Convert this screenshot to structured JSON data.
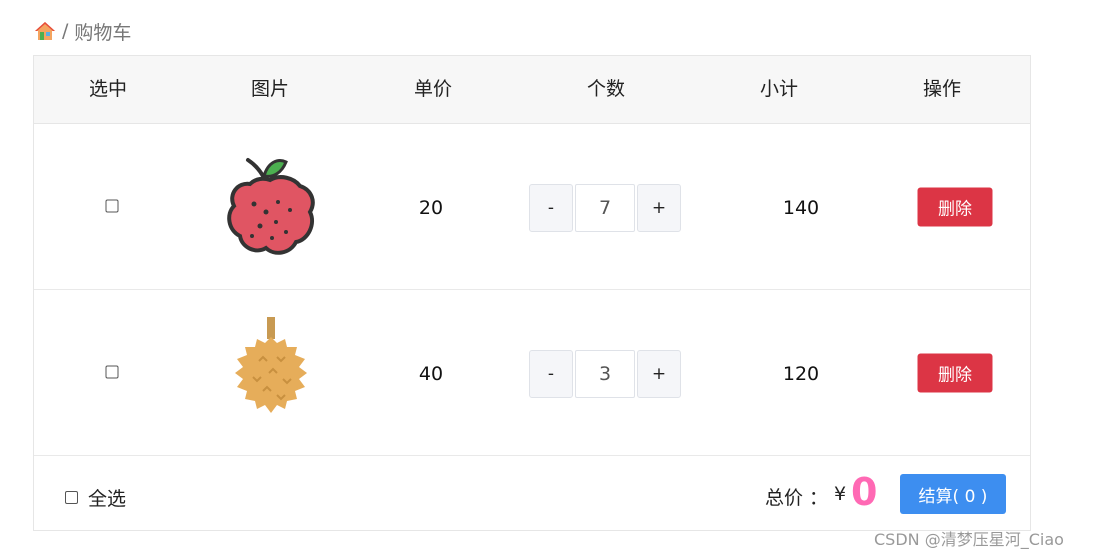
{
  "breadcrumb": {
    "home_icon": "home-icon",
    "separator": "/",
    "current": "购物车"
  },
  "table": {
    "headers": [
      "选中",
      "图片",
      "单价",
      "个数",
      "小计",
      "操作"
    ],
    "rows": [
      {
        "checked": false,
        "image": "lychee",
        "price": "20",
        "quantity": "7",
        "subtotal": "140",
        "decrease_label": "-",
        "increase_label": "+",
        "delete_label": "删除"
      },
      {
        "checked": false,
        "image": "durian",
        "price": "40",
        "quantity": "3",
        "subtotal": "120",
        "decrease_label": "-",
        "increase_label": "+",
        "delete_label": "删除"
      }
    ]
  },
  "footer": {
    "select_all_label": "全选",
    "total_label": "总价 ：",
    "currency": "¥",
    "total_value": "0",
    "checkout_label": "结算( 0 )"
  },
  "watermark": "CSDN @清梦压星河_Ciao",
  "colors": {
    "delete_button": "#dc3545",
    "checkout_button": "#3d8ef0",
    "total_value": "#ff69b4",
    "header_bg": "#f7f7f7"
  }
}
